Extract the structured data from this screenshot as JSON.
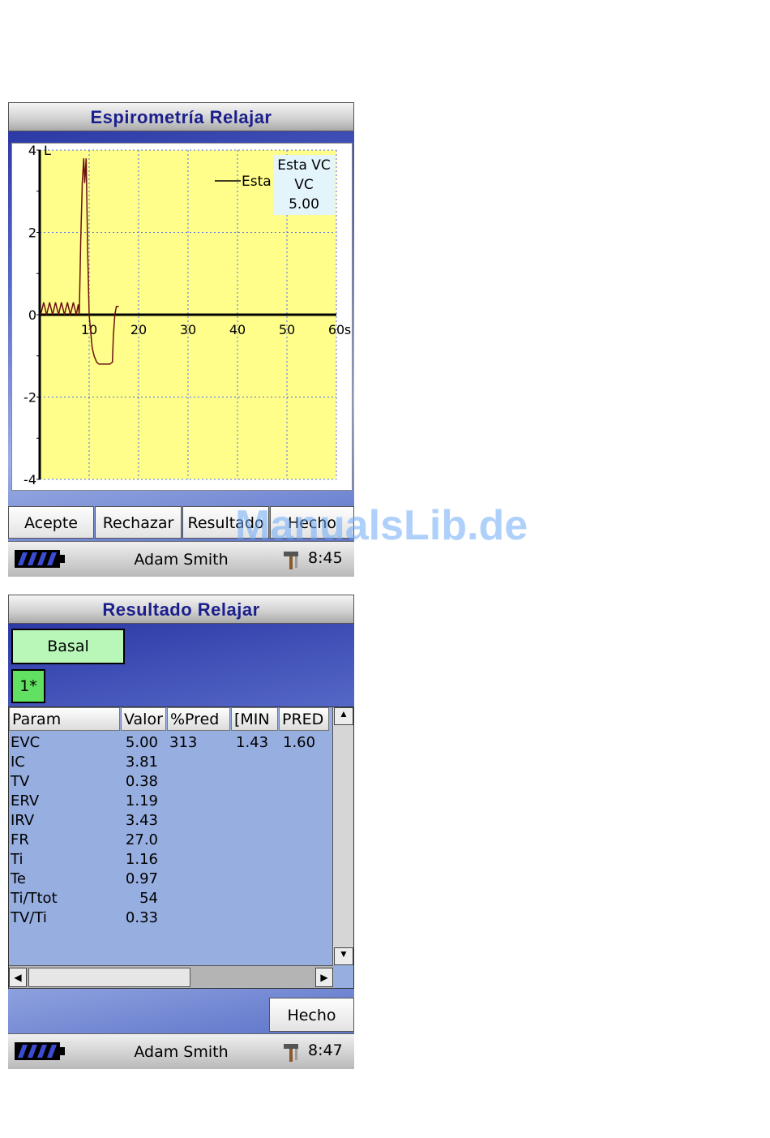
{
  "screen1": {
    "title": "Espirometría Relajar",
    "chart_data": {
      "type": "line",
      "x_unit": "s",
      "y_unit": "L",
      "xlim": [
        0,
        60
      ],
      "ylim": [
        -4,
        4
      ],
      "x_ticks": [
        "10",
        "20",
        "30",
        "40",
        "50",
        "60",
        "s"
      ],
      "y_ticks": [
        "4",
        "L",
        "2",
        "0",
        "-2",
        "-4"
      ],
      "grid": true,
      "series": [
        {
          "name": "Esta",
          "color": "#6b1010",
          "x": [
            0.2,
            0.8,
            1.4,
            2.0,
            2.6,
            3.2,
            3.8,
            4.4,
            5.0,
            5.6,
            6.2,
            6.8,
            7.4,
            7.8,
            8.0,
            8.3,
            8.6,
            8.9,
            9.1,
            9.4,
            9.7,
            10.0,
            10.3,
            10.6,
            11.0,
            11.5,
            12.0,
            12.6,
            13.5,
            14.2,
            14.7,
            14.9,
            15.2,
            15.5,
            16.0
          ],
          "y": [
            0.0,
            0.3,
            0.0,
            0.3,
            0.0,
            0.3,
            0.0,
            0.3,
            0.0,
            0.3,
            0.0,
            0.3,
            0.0,
            0.25,
            0.0,
            1.8,
            3.2,
            3.8,
            3.2,
            3.8,
            1.5,
            0.0,
            -0.4,
            -0.8,
            -1.0,
            -1.15,
            -1.2,
            -1.2,
            -1.2,
            -1.2,
            -1.15,
            -0.5,
            0.0,
            0.2,
            0.2
          ]
        }
      ],
      "legend_label": "Esta",
      "legend_position": "top-right",
      "summary_box": {
        "line1": "Esta VC",
        "line2": "VC",
        "line3": "5.00"
      }
    },
    "buttons": [
      "Acepte",
      "Rechazar",
      "Resultado",
      "Hecho"
    ],
    "status": {
      "user": "Adam Smith",
      "time": "8:45"
    }
  },
  "watermark": "ManualsLib.de",
  "screen2": {
    "title": "Resultado Relajar",
    "basal_label": "Basal",
    "trial_label": "1*",
    "columns": [
      "Param",
      "Valor",
      "%Pred",
      "[MIN",
      "PRED"
    ],
    "rows": [
      {
        "param": "EVC",
        "valor": "5.00",
        "pred_pct": "313",
        "min": "1.43",
        "pred": "1.60"
      },
      {
        "param": "IC",
        "valor": "3.81",
        "pred_pct": "",
        "min": "",
        "pred": ""
      },
      {
        "param": "TV",
        "valor": "0.38",
        "pred_pct": "",
        "min": "",
        "pred": ""
      },
      {
        "param": "ERV",
        "valor": "1.19",
        "pred_pct": "",
        "min": "",
        "pred": ""
      },
      {
        "param": "IRV",
        "valor": "3.43",
        "pred_pct": "",
        "min": "",
        "pred": ""
      },
      {
        "param": "FR",
        "valor": "27.0",
        "pred_pct": "",
        "min": "",
        "pred": ""
      },
      {
        "param": "Ti",
        "valor": "1.16",
        "pred_pct": "",
        "min": "",
        "pred": ""
      },
      {
        "param": "Te",
        "valor": "0.97",
        "pred_pct": "",
        "min": "",
        "pred": ""
      },
      {
        "param": "Ti/Ttot",
        "valor": "54",
        "pred_pct": "",
        "min": "",
        "pred": ""
      },
      {
        "param": "TV/Ti",
        "valor": "0.33",
        "pred_pct": "",
        "min": "",
        "pred": ""
      }
    ],
    "done_label": "Hecho",
    "status": {
      "user": "Adam Smith",
      "time": "8:47"
    }
  },
  "icons": {
    "battery": "battery-icon",
    "tools": "tools-icon",
    "scroll_up": "arrow-up-icon",
    "scroll_down": "arrow-down-icon",
    "scroll_left": "arrow-left-icon",
    "scroll_right": "arrow-right-icon"
  }
}
